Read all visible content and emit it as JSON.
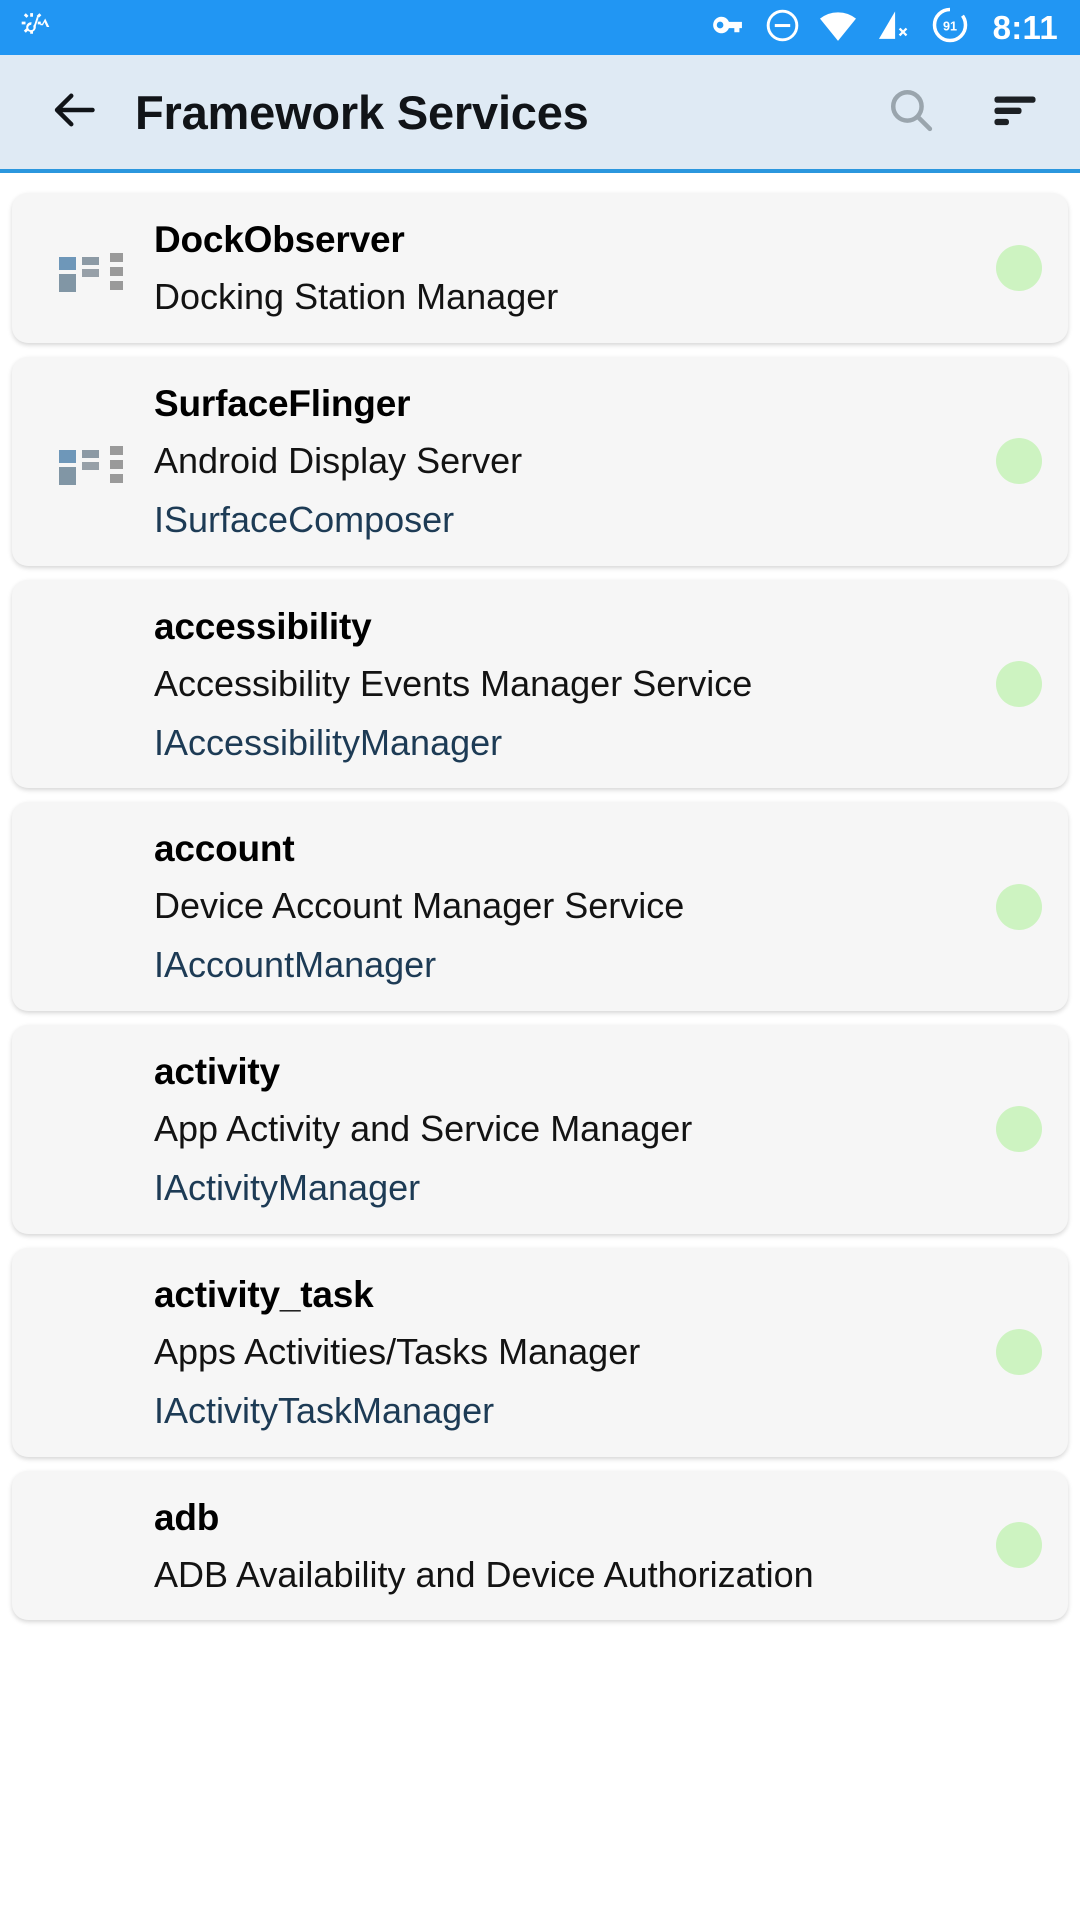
{
  "status_bar": {
    "background_color": "#2196f3",
    "left_icons": [
      "settings-activity-icon"
    ],
    "right_icons": [
      "vpn-key-icon",
      "do-not-disturb-icon",
      "wifi-icon",
      "cellular-off-icon"
    ],
    "battery_level": "91",
    "clock": "8:11"
  },
  "app_bar": {
    "background_color": "#dfeaf4",
    "back_label": "back-arrow",
    "title": "Framework Services",
    "search_label": "search-icon",
    "sort_label": "sort-icon"
  },
  "list": {
    "accent_color": "#1d3b55",
    "status_dot_color": "#cdf3c1",
    "items": [
      {
        "icon": "dock-window-icon",
        "name": "DockObserver",
        "description": "Docking Station Manager",
        "interface": "",
        "status": "active"
      },
      {
        "icon": "dock-window-icon",
        "name": "SurfaceFlinger",
        "description": "Android Display Server",
        "interface": "ISurfaceComposer",
        "status": "active"
      },
      {
        "icon": "android-robot-icon",
        "name": "accessibility",
        "description": "Accessibility Events Manager Service",
        "interface": "IAccessibilityManager",
        "status": "active"
      },
      {
        "icon": "android-robot-icon",
        "name": "account",
        "description": "Device Account Manager Service",
        "interface": "IAccountManager",
        "status": "active"
      },
      {
        "icon": "android-robot-icon",
        "name": "activity",
        "description": "App Activity and Service Manager",
        "interface": "IActivityManager",
        "status": "active"
      },
      {
        "icon": "android-robot-icon",
        "name": "activity_task",
        "description": "Apps Activities/Tasks Manager",
        "interface": "IActivityTaskManager",
        "status": "active"
      },
      {
        "icon": "android-robot-icon",
        "name": "adb",
        "description": "ADB Availability and Device Authorization",
        "interface": "",
        "status": "active"
      }
    ]
  }
}
